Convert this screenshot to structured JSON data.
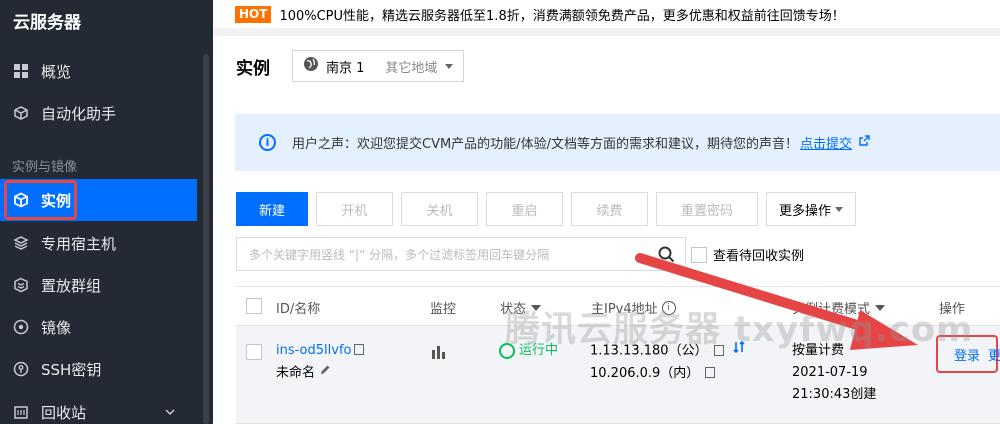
{
  "sidebar": {
    "title": "云服务器",
    "items": [
      {
        "label": "概览",
        "icon": "grid-icon"
      },
      {
        "label": "自动化助手",
        "icon": "box-icon"
      }
    ],
    "section_label": "实例与镜像",
    "section_items": [
      {
        "label": "实例",
        "icon": "cube-icon",
        "active": true
      },
      {
        "label": "专用宿主机",
        "icon": "layers-icon"
      },
      {
        "label": "置放群组",
        "icon": "group-icon"
      },
      {
        "label": "镜像",
        "icon": "disc-icon"
      },
      {
        "label": "SSH密钥",
        "icon": "key-icon"
      },
      {
        "label": "回收站",
        "icon": "recycle-icon"
      }
    ]
  },
  "promo": {
    "badge": "HOT",
    "text": "100%CPU性能，精选云服务器低至1.8折，消费满额领免费产品，更多优惠和权益前往回馈专场！"
  },
  "header": {
    "title": "实例",
    "region_selected": "南京 1",
    "region_other": "其它地域"
  },
  "notice": {
    "text": "用户之声：欢迎您提交CVM产品的功能/体验/文档等方面的需求和建议，期待您的声音！",
    "link": "点击提交"
  },
  "toolbar": {
    "new": "新建",
    "start": "开机",
    "shutdown": "关机",
    "restart": "重启",
    "renew": "续费",
    "reset_password": "重置密码",
    "more": "更多操作"
  },
  "search": {
    "placeholder": "多个关键字用竖线 “|” 分隔，多个过滤标签用回车键分隔"
  },
  "recycle_checkbox": "查看待回收实例",
  "table": {
    "headers": {
      "id_name": "ID/名称",
      "monitor": "监控",
      "status": "状态",
      "ipv4": "主IPv4地址",
      "billing": "实例计费模式",
      "actions": "操作"
    },
    "rows": [
      {
        "id": "ins-od5llvfo",
        "name": "未命名",
        "status": "运行中",
        "ip_public": "1.13.13.180（公）",
        "ip_private": "10.206.0.9（内）",
        "billing": "按量计费",
        "date": "2021-07-19",
        "created": "21:30:43创建",
        "action_login": "登录",
        "action_more": "更多"
      }
    ]
  },
  "watermark": "腾讯云服务器 txyfwq.com",
  "colors": {
    "accent": "#006eff",
    "sidebar_bg": "#232a34",
    "highlight": "#e54545",
    "status_running": "#0abf5b"
  }
}
